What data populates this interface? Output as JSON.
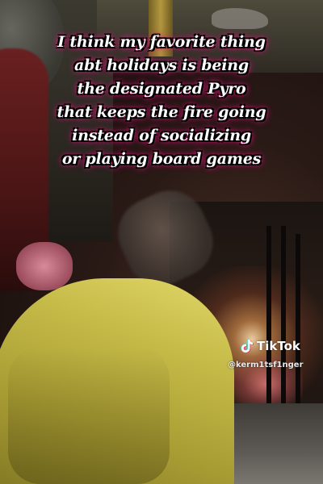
{
  "caption": {
    "lines": [
      "I think my favorite thing",
      "abt holidays is being",
      "the designated Pyro",
      "that keeps the fire going",
      "instead of socializing",
      "or playing board games"
    ],
    "text_color": "#ffffff",
    "glow_color": "#ff1a8c"
  },
  "watermark": {
    "brand": "TikTok",
    "handle": "@kerm1tsf1nger",
    "icon": "tiktok-note-icon"
  }
}
